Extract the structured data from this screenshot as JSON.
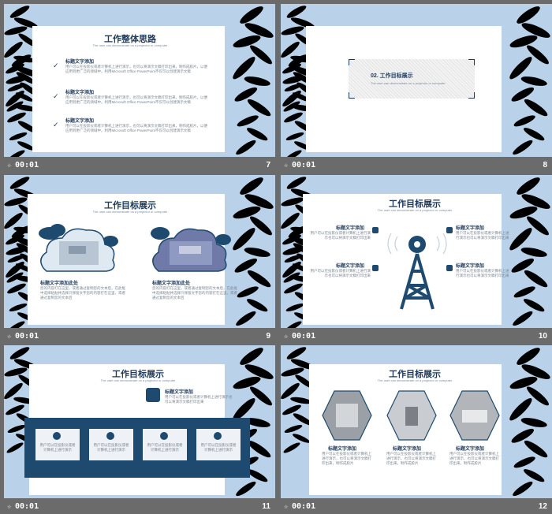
{
  "slides": [
    {
      "number": "7",
      "time": "00:01",
      "title": "工作整体思路",
      "subtitle": "The user can demonstrate on a projector or computer",
      "items": [
        {
          "heading": "标题文字添加",
          "text": "用户可以在投影仪或者计算机上进行演示，也可以将演示文稿打印出来，制作成胶片，以便应用到更广泛的领域中。利用Microsoft Office PowerPoint不仅可以创建演示文稿"
        },
        {
          "heading": "标题文字添加",
          "text": "用户可以在投影仪或者计算机上进行演示，也可以将演示文稿打印出来，制作成胶片，以便应用到更广泛的领域中。利用Microsoft Office PowerPoint不仅可以创建演示文稿"
        },
        {
          "heading": "标题文字添加",
          "text": "用户可以在投影仪或者计算机上进行演示，也可以将演示文稿打印出来，制作成胶片，以便应用到更广泛的领域中。利用Microsoft Office PowerPoint不仅可以创建演示文稿"
        }
      ]
    },
    {
      "number": "8",
      "time": "00:01",
      "title": "02. 工作目标展示",
      "subtitle": "The user can demonstrate on a projector or computer"
    },
    {
      "number": "9",
      "time": "00:01",
      "title": "工作目标展示",
      "subtitle": "The user can demonstrate on a projector or computer",
      "items": [
        {
          "heading": "标题文字添加此处",
          "text": "您的内容打在这里，或者通过复制您的文本后，在此框中选择粘贴并选择只保留文字您的内容打在这里，或者通过复制您的文本后"
        },
        {
          "heading": "标题文字添加此处",
          "text": "您的内容打在这里，或者通过复制您的文本后，在此框中选择粘贴并选择只保留文字您的内容打在这里，或者通过复制您的文本后"
        }
      ]
    },
    {
      "number": "10",
      "time": "00:01",
      "title": "工作目标展示",
      "subtitle": "The user can demonstrate on a projector or computer",
      "items": [
        {
          "heading": "标题文字添加",
          "text": "用户可以在投影仪或者计算机上进行演示也可以将演示文稿打印出来"
        },
        {
          "heading": "标题文字添加",
          "text": "用户可以在投影仪或者计算机上进行演示也可以将演示文稿打印出来"
        },
        {
          "heading": "标题文字添加",
          "text": "用户可以在投影仪或者计算机上进行演示也可以将演示文稿打印出来"
        },
        {
          "heading": "标题文字添加",
          "text": "用户可以在投影仪或者计算机上进行演示也可以将演示文稿打印出来"
        }
      ]
    },
    {
      "number": "11",
      "time": "00:01",
      "title": "工作目标展示",
      "subtitle": "The user can demonstrate on a projector or computer",
      "top_heading": "标题文字添加",
      "top_text": "用户可以在投影仪或者计算机上进行演示也可以将演示文稿打印出来",
      "boxes": [
        "用户可以在投影仪或者计算机上进行演示",
        "用户可以在投影仪或者计算机上进行演示",
        "用户可以在投影仪或者计算机上进行演示",
        "用户可以在投影仪或者计算机上进行演示"
      ]
    },
    {
      "number": "12",
      "time": "00:01",
      "title": "工作目标展示",
      "subtitle": "The user can demonstrate on a projector or computer",
      "items": [
        {
          "heading": "标题文字添加",
          "text": "用户可以在投影仪或者计算机上进行演示，也可以将演示文稿打印出来，制作成胶片"
        },
        {
          "heading": "标题文字添加",
          "text": "用户可以在投影仪或者计算机上进行演示，也可以将演示文稿打印出来，制作成胶片"
        },
        {
          "heading": "标题文字添加",
          "text": "用户可以在投影仪或者计算机上进行演示，也可以将演示文稿打印出来，制作成胶片"
        }
      ]
    }
  ],
  "colors": {
    "navy": "#1d4a6e",
    "sky": "#b9d2e9",
    "leaf": "#2d6a34",
    "background": "#6b6b6b"
  },
  "icons": {
    "transition": "star-icon",
    "check": "check-icon",
    "tower": "signal-tower-icon",
    "cloud": "cloud-icon"
  }
}
